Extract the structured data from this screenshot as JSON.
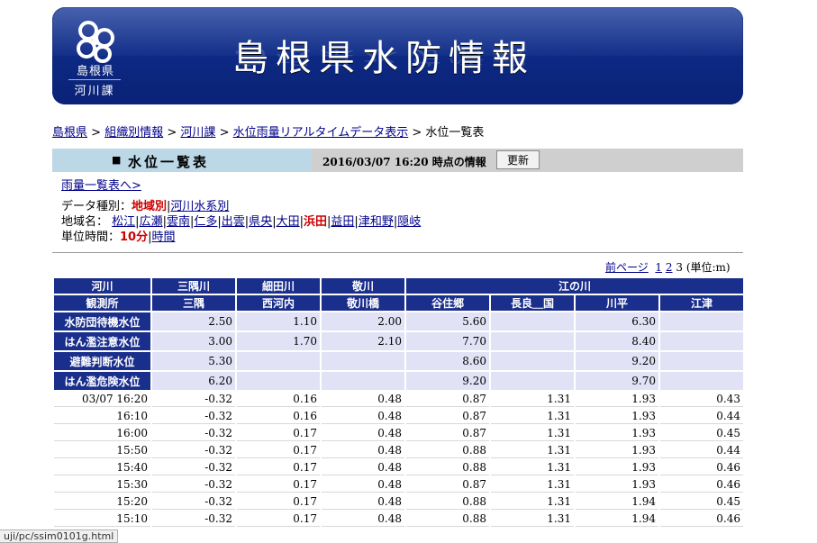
{
  "banner": {
    "logo_line1": "島根県",
    "logo_line2": "河川課",
    "title": "島根県水防情報",
    "accent_color": "#0d2a86"
  },
  "breadcrumb": {
    "items": [
      "島根県",
      "組織別情報",
      "河川課",
      "水位雨量リアルタイムデータ表示"
    ],
    "current": "水位一覧表",
    "separator": ">"
  },
  "header": {
    "bullet": "■",
    "page_title": "水位一覧表",
    "timestamp": "2016/03/07 16:20 時点の情報",
    "update_button": "更新"
  },
  "rain_link": "雨量一覧表へ>",
  "filters": {
    "data_type_label": "データ種別：",
    "data_type_active": "地域別",
    "data_type_other": "河川水系別",
    "area_label": "地域名：",
    "areas": [
      {
        "name": "松江",
        "active": false
      },
      {
        "name": "広瀬",
        "active": false
      },
      {
        "name": "雲南",
        "active": false
      },
      {
        "name": "仁多",
        "active": false
      },
      {
        "name": "出雲",
        "active": false
      },
      {
        "name": "県央",
        "active": false
      },
      {
        "name": "大田",
        "active": false
      },
      {
        "name": "浜田",
        "active": true
      },
      {
        "name": "益田",
        "active": false
      },
      {
        "name": "津和野",
        "active": false
      },
      {
        "name": "隠岐",
        "active": false
      }
    ],
    "unit_label": "単位時間：",
    "unit_active": "10分",
    "unit_other": "時間"
  },
  "pager": {
    "prev": "前ページ",
    "pages": [
      "1",
      "2"
    ],
    "current": "3",
    "unit": "(単位:m)"
  },
  "table": {
    "river_label": "河川",
    "station_label": "観測所",
    "rivers": [
      {
        "name": "三隅川",
        "span": 1
      },
      {
        "name": "細田川",
        "span": 1
      },
      {
        "name": "敬川",
        "span": 1
      },
      {
        "name": "江の川",
        "span": 4
      }
    ],
    "stations": [
      "三隅",
      "西河内",
      "敬川橋",
      "谷住郷",
      "長良＿国",
      "川平",
      "江津"
    ],
    "levels": [
      {
        "label": "水防団待機水位",
        "values": [
          "2.50",
          "1.10",
          "2.00",
          "5.60",
          "",
          "6.30",
          ""
        ]
      },
      {
        "label": "はん濫注意水位",
        "values": [
          "3.00",
          "1.70",
          "2.10",
          "7.70",
          "",
          "8.40",
          ""
        ]
      },
      {
        "label": "避難判断水位",
        "values": [
          "5.30",
          "",
          "",
          "8.60",
          "",
          "9.20",
          ""
        ]
      },
      {
        "label": "はん濫危険水位",
        "values": [
          "6.20",
          "",
          "",
          "9.20",
          "",
          "9.70",
          ""
        ]
      }
    ],
    "rows": [
      {
        "time": "03/07 16:20",
        "values": [
          "-0.32",
          "0.16",
          "0.48",
          "0.87",
          "1.31",
          "1.93",
          "0.43"
        ]
      },
      {
        "time": "16:10",
        "values": [
          "-0.32",
          "0.16",
          "0.48",
          "0.87",
          "1.31",
          "1.93",
          "0.44"
        ]
      },
      {
        "time": "16:00",
        "values": [
          "-0.32",
          "0.17",
          "0.48",
          "0.87",
          "1.31",
          "1.93",
          "0.45"
        ]
      },
      {
        "time": "15:50",
        "values": [
          "-0.32",
          "0.17",
          "0.48",
          "0.88",
          "1.31",
          "1.93",
          "0.44"
        ]
      },
      {
        "time": "15:40",
        "values": [
          "-0.32",
          "0.17",
          "0.48",
          "0.88",
          "1.31",
          "1.93",
          "0.46"
        ]
      },
      {
        "time": "15:30",
        "values": [
          "-0.32",
          "0.17",
          "0.48",
          "0.87",
          "1.31",
          "1.93",
          "0.46"
        ]
      },
      {
        "time": "15:20",
        "values": [
          "-0.32",
          "0.17",
          "0.48",
          "0.88",
          "1.31",
          "1.94",
          "0.45"
        ]
      },
      {
        "time": "15:10",
        "values": [
          "-0.32",
          "0.17",
          "0.48",
          "0.88",
          "1.31",
          "1.94",
          "0.46"
        ]
      }
    ]
  },
  "statusbar": "uji/pc/ssim0101g.html"
}
